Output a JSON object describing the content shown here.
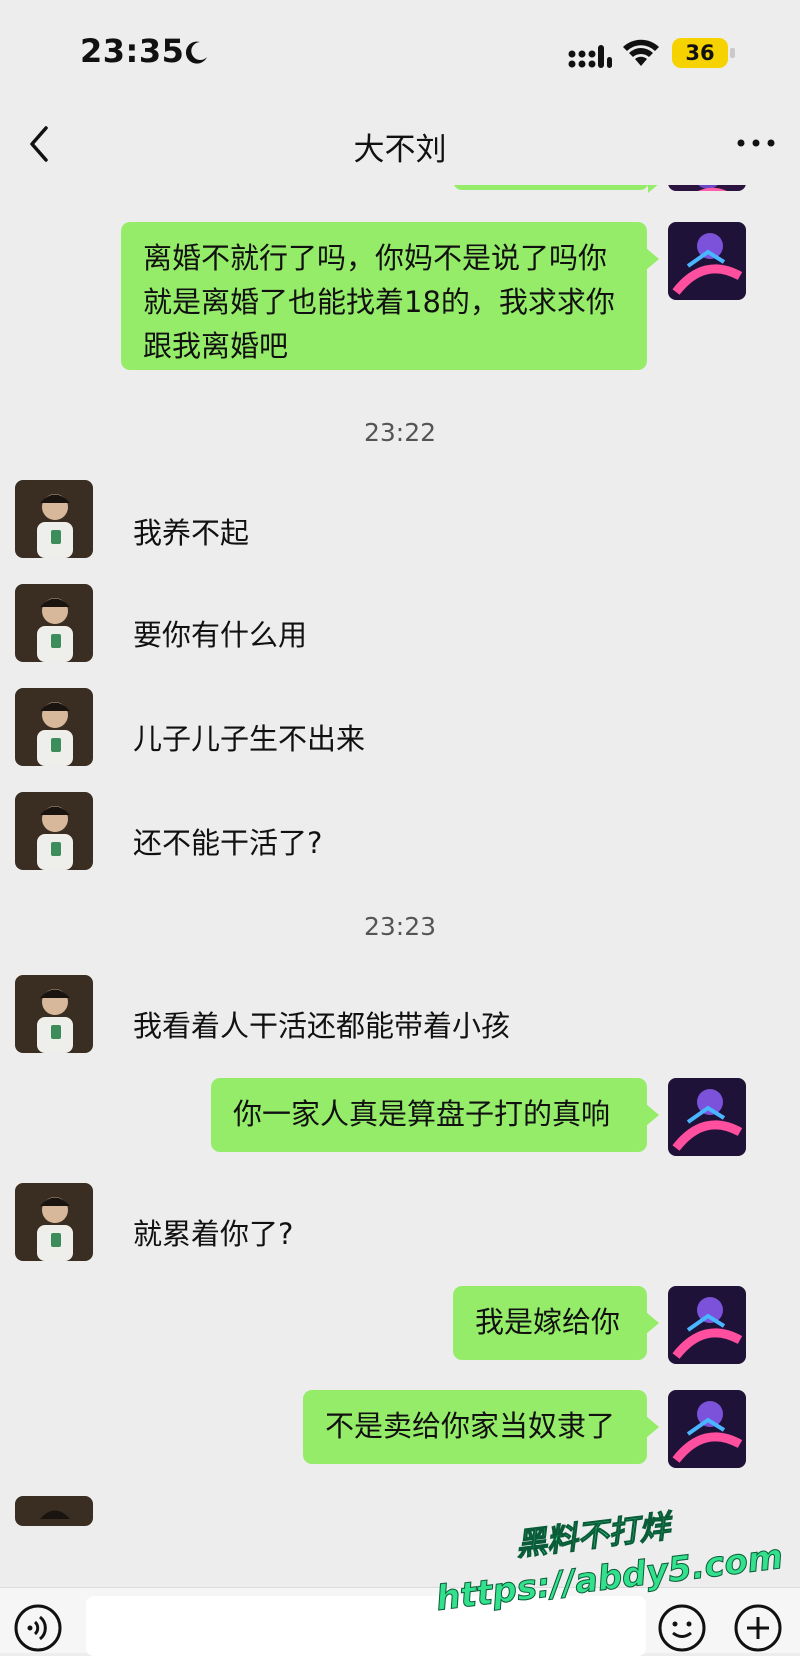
{
  "status_bar": {
    "time": "23:35",
    "battery": "36",
    "icons": [
      "moon-icon",
      "signal-icon",
      "wifi-icon",
      "battery-icon"
    ]
  },
  "nav": {
    "title": "大不刘",
    "back_icon": "chevron-left-icon",
    "more_icon": "more-icon"
  },
  "messages": [
    {
      "side": "right",
      "text": "离婚不就行了吗，你妈不是说了吗你就是离婚了也能找着18的，我求求你跟我离婚吧"
    },
    {
      "side": "timestamp",
      "text": "23:22"
    },
    {
      "side": "left",
      "text": "我养不起"
    },
    {
      "side": "left",
      "text": "要你有什么用"
    },
    {
      "side": "left",
      "text": "儿子儿子生不出来"
    },
    {
      "side": "left",
      "text": "还不能干活了?"
    },
    {
      "side": "timestamp",
      "text": "23:23"
    },
    {
      "side": "left",
      "text": "我看着人干活还都能带着小孩"
    },
    {
      "side": "right",
      "text": "你一家人真是算盘子打的真响"
    },
    {
      "side": "left",
      "text": "就累着你了?"
    },
    {
      "side": "right",
      "text": "我是嫁给你"
    },
    {
      "side": "right",
      "text": "不是卖给你家当奴隶了"
    }
  ],
  "watermark": {
    "line1": "黑料不打烊",
    "line2": "https://abdy5.com"
  },
  "input_bar": {
    "icons": [
      "voice-icon",
      "emoji-icon",
      "plus-icon"
    ]
  },
  "colors": {
    "background": "#ededed",
    "bubble_green": "#95ec69",
    "battery_yellow": "#f6d200",
    "watermark_green": "#33e08c"
  }
}
